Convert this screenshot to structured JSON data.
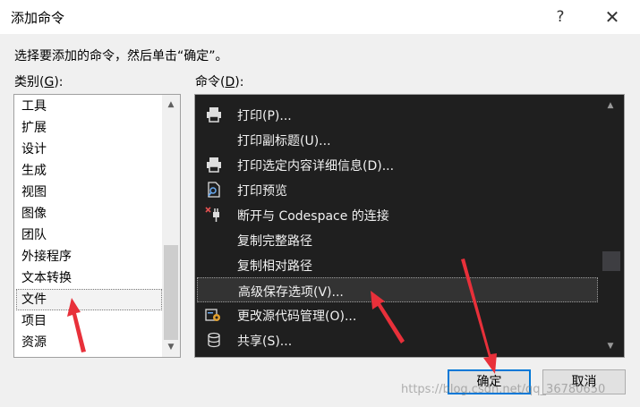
{
  "dialog": {
    "title": "添加命令",
    "help_glyph": "?",
    "close_glyph": "✕",
    "instruction": "选择要添加的命令，然后单击“确定”。"
  },
  "categories": {
    "label_prefix": "类别(",
    "label_key": "G",
    "label_suffix": "):",
    "items": [
      "工具",
      "扩展",
      "设计",
      "生成",
      "视图",
      "图像",
      "团队",
      "外接程序",
      "文本转换",
      "文件",
      "项目",
      "资源"
    ],
    "selected": "文件"
  },
  "commands": {
    "label_prefix": "命令(",
    "label_key": "D",
    "label_suffix": "):",
    "items": [
      {
        "label": "打印(P)...",
        "icon": "printer-icon"
      },
      {
        "label": "打印副标题(U)...",
        "icon": ""
      },
      {
        "label": "打印选定内容详细信息(D)...",
        "icon": "printer-icon"
      },
      {
        "label": "打印预览",
        "icon": "print-preview-icon"
      },
      {
        "label": "断开与 Codespace 的连接",
        "icon": "disconnect-plug-icon"
      },
      {
        "label": "复制完整路径",
        "icon": ""
      },
      {
        "label": "复制相对路径",
        "icon": ""
      },
      {
        "label": "高级保存选项(V)...",
        "icon": ""
      },
      {
        "label": "更改源代码管理(O)...",
        "icon": "source-control-icon"
      },
      {
        "label": "共享(S)...",
        "icon": "share-icon"
      }
    ],
    "selected": "高级保存选项(V)..."
  },
  "buttons": {
    "ok": "确定",
    "cancel": "取消"
  },
  "watermark": "https://blog.csdn.net/qq_36780650",
  "colors": {
    "annotation_arrow": "#e8303a",
    "command_bg": "#1f1f1f",
    "ok_border": "#0078d7"
  }
}
